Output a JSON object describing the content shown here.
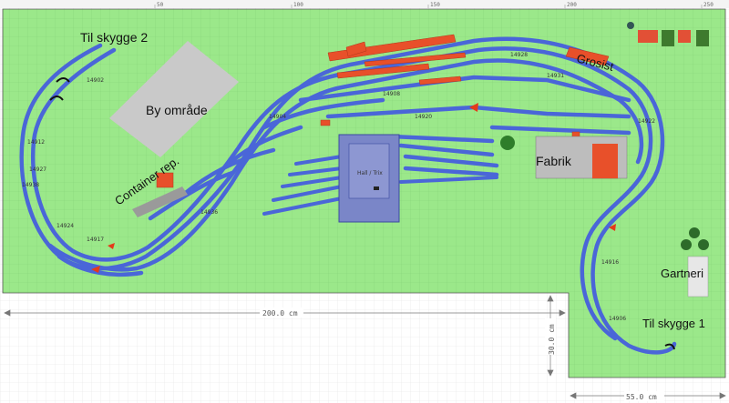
{
  "ruler": {
    "marks": [
      "50",
      "100",
      "150",
      "200",
      "250"
    ]
  },
  "labels": {
    "shadow_2": "Til skygge 2",
    "city": "By område",
    "container": "Container rep.",
    "grocer": "Grosist",
    "factory": "Fabrik",
    "gardener": "Gartneri",
    "shadow_1": "Til skygge 1",
    "turntable": "Hall / Trix"
  },
  "dimensions": {
    "width_200": "200.0 cm",
    "height_30": "30.0 cm",
    "width_55": "55.0 cm"
  },
  "track_ids": [
    "14902",
    "14912",
    "14927",
    "14938",
    "14924",
    "14917",
    "14904",
    "14908",
    "14922",
    "14916",
    "14920",
    "14928",
    "14931",
    "14906",
    "14936"
  ],
  "colors": {
    "board": "#9be88a",
    "track": "#4a66d8",
    "building": "#e8502a",
    "city": "#cccccc",
    "station": "#7a86c8"
  }
}
